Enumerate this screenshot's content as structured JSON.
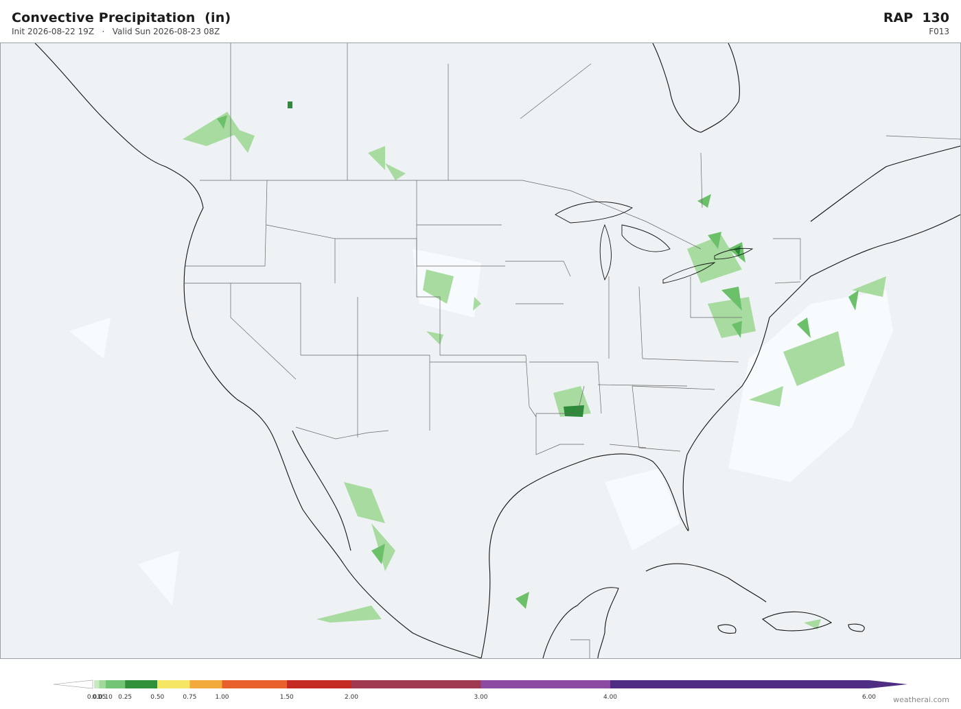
{
  "header": {
    "title": "Convective Precipitation  (in)",
    "init": "Init 2026-08-22 19Z",
    "separator": "·",
    "valid": "Valid Sun 2026-08-23 08Z",
    "model": "RAP  130",
    "forecast_hour": "F013"
  },
  "credit": "weatherai.com",
  "colors": {
    "ocean_land": "#eef2f5",
    "coast": "#111111",
    "borders": "#555555",
    "precip_trace": "#f7fbfd",
    "precip_light": "#a8dba0",
    "precip_medium": "#6cc06a",
    "precip_heavy": "#2e8b3a"
  },
  "colorbar": {
    "levels": [
      "0.01",
      "0.05",
      "0.10",
      "0.25",
      "0.50",
      "0.75",
      "1.00",
      "1.50",
      "2.00",
      "3.00",
      "4.00",
      "6.00"
    ],
    "values": [
      0.01,
      0.05,
      0.1,
      0.25,
      0.5,
      0.75,
      1.0,
      1.5,
      2.0,
      3.0,
      4.0,
      6.0
    ],
    "colors": [
      "#c7e9c0",
      "#a1d99b",
      "#74c476",
      "#31913a",
      "#f5e663",
      "#f2ab3a",
      "#e8612c",
      "#c52a22",
      "#a03a50",
      "#8c4aa3",
      "#4e2d82"
    ]
  },
  "precip_areas": [
    {
      "region": "British Columbia coast",
      "intensity": "light"
    },
    {
      "region": "Northern Rockies",
      "intensity": "light"
    },
    {
      "region": "Great Lakes / Ontario",
      "intensity": "heavy"
    },
    {
      "region": "Pennsylvania / New York",
      "intensity": "heavy"
    },
    {
      "region": "Mid-Atlantic coast",
      "intensity": "medium"
    },
    {
      "region": "Western Atlantic",
      "intensity": "medium"
    },
    {
      "region": "Arkansas / Louisiana",
      "intensity": "heavy"
    },
    {
      "region": "Colorado / Nebraska",
      "intensity": "light"
    },
    {
      "region": "Sierra Madre Occidental",
      "intensity": "heavy"
    },
    {
      "region": "Yucatan",
      "intensity": "medium"
    },
    {
      "region": "Hispaniola",
      "intensity": "light"
    }
  ]
}
